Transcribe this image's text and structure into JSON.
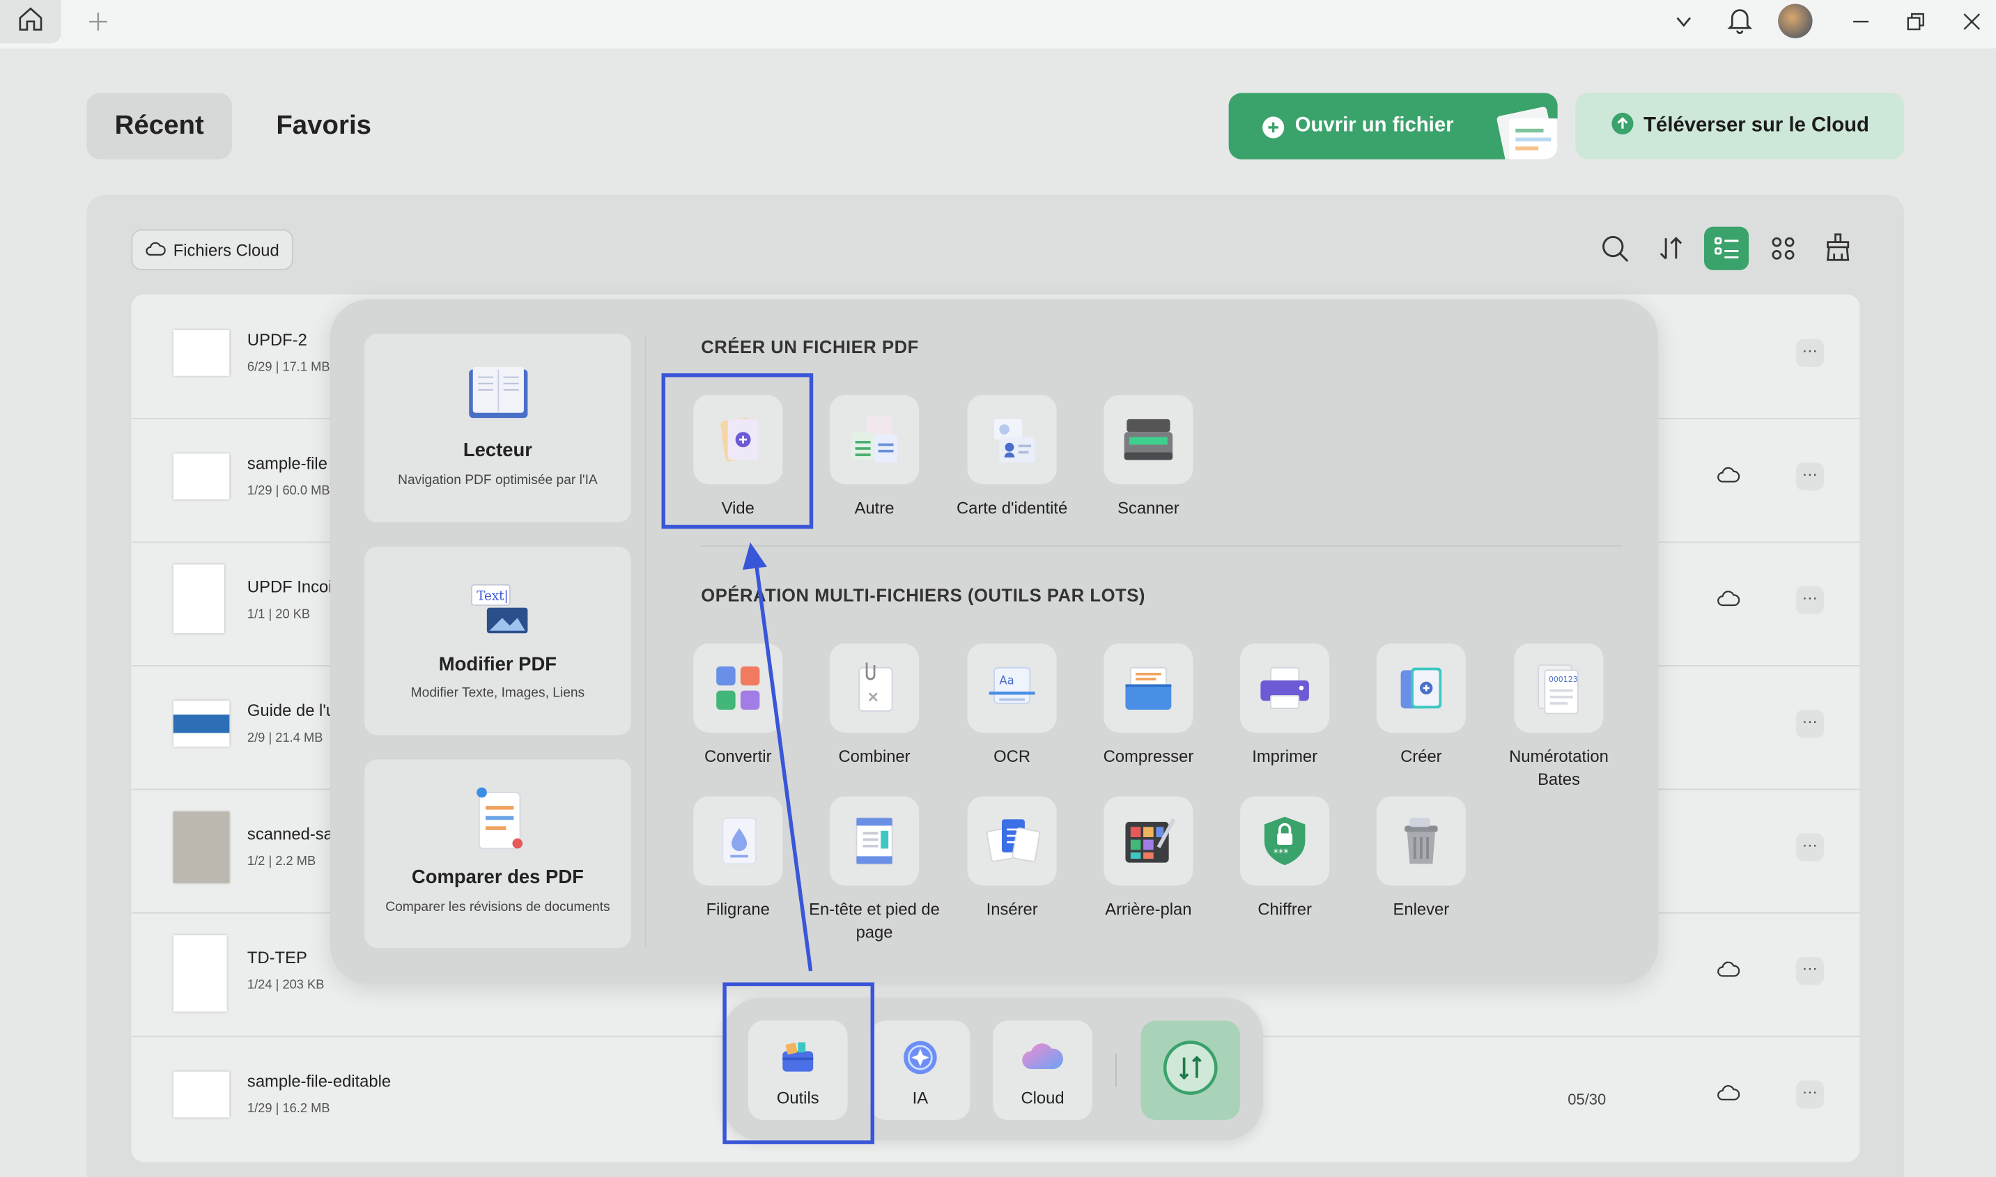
{
  "tabs": {
    "recent": "Récent",
    "favorites": "Favoris"
  },
  "actions": {
    "open_file": "Ouvrir un fichier",
    "upload_cloud": "Téléverser sur le Cloud"
  },
  "cloud_files_label": "Fichiers Cloud",
  "files": [
    {
      "name": "UPDF-2",
      "meta": "6/29 | 17.1 MB"
    },
    {
      "name": "sample-file",
      "meta": "1/29 | 60.0 MB"
    },
    {
      "name": "UPDF Incoi",
      "meta": "1/1 | 20 KB"
    },
    {
      "name": "Guide de l'u",
      "meta": "2/9 | 21.4 MB"
    },
    {
      "name": "scanned-sa",
      "meta": "1/2 | 2.2 MB"
    },
    {
      "name": "TD-TEP",
      "meta": "1/24 | 203 KB"
    },
    {
      "name": "sample-file-editable",
      "meta": "1/29 | 16.2 MB"
    }
  ],
  "page_counter": "05/30",
  "cards": [
    {
      "title": "Lecteur",
      "subtitle": "Navigation PDF optimisée par l'IA"
    },
    {
      "title": "Modifier PDF",
      "subtitle": "Modifier Texte, Images, Liens"
    },
    {
      "title": "Comparer des PDF",
      "subtitle": "Comparer les révisions de documents"
    }
  ],
  "create_section": {
    "title": "CRÉER UN FICHIER PDF",
    "items": [
      "Vide",
      "Autre",
      "Carte d'identité",
      "Scanner"
    ]
  },
  "batch_section": {
    "title": "OPÉRATION MULTI-FICHIERS (OUTILS PAR LOTS)",
    "row1": [
      "Convertir",
      "Combiner",
      "OCR",
      "Compresser",
      "Imprimer",
      "Créer",
      "Numérotation Bates"
    ],
    "row2": [
      "Filigrane",
      "En-tête et pied de page",
      "Insérer",
      "Arrière-plan",
      "Chiffrer",
      "Enlever"
    ]
  },
  "dock": {
    "tools": "Outils",
    "ai": "IA",
    "cloud": "Cloud"
  },
  "colors": {
    "accent": "#3aa26b",
    "highlight": "#3a56d8"
  }
}
